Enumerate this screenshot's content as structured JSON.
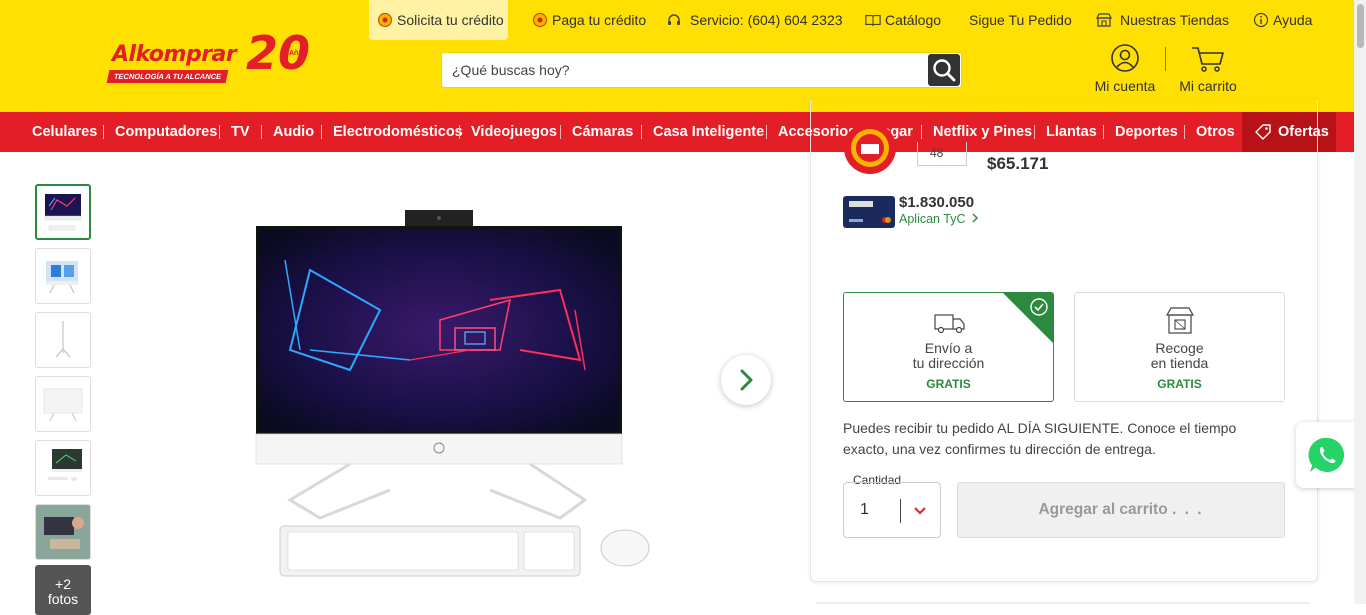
{
  "brand": {
    "name": "Alkomprar",
    "tagline": "TECNOLOGÍA A TU ALCANCE",
    "anniversary": "20",
    "anniversary_label": "Años"
  },
  "utility_bar": {
    "credit": "Solicita tu crédito",
    "pay_credit": "Paga tu crédito",
    "service": "Servicio: (604) 604 2323",
    "catalog": "Catálogo",
    "track_order": "Sigue Tu Pedido",
    "stores": "Nuestras Tiendas",
    "help": "Ayuda"
  },
  "search": {
    "placeholder": "¿Qué buscas hoy?"
  },
  "account": {
    "my_account": "Mi cuenta",
    "my_cart": "Mi carrito"
  },
  "nav": {
    "items": [
      "Celulares",
      "Computadores",
      "TV",
      "Audio",
      "Electrodomésticos",
      "Videojuegos",
      "Cámaras",
      "Casa Inteligente",
      "Accesorios",
      "Hogar",
      "Netflix y Pines",
      "Llantas",
      "Deportes",
      "Otros"
    ],
    "offers": "Ofertas"
  },
  "gallery": {
    "more_photos": "+2\nfotos"
  },
  "pricing": {
    "installments": "48",
    "installment_price": "$65.171",
    "card_price": "$1.830.050",
    "terms": "Aplican TyC"
  },
  "delivery": {
    "home_title": "Envío a\ntu dirección",
    "home_price": "GRATIS",
    "store_title": "Recoge\nen tienda",
    "store_price": "GRATIS",
    "info": "Puedes recibir tu pedido AL DÍA SIGUIENTE. Conoce el tiempo exacto, una vez confirmes tu dirección de entrega."
  },
  "purchase": {
    "quantity_label": "Cantidad",
    "quantity": "1",
    "add_to_cart": "Agregar al carrito"
  },
  "colors": {
    "brand_yellow": "#ffe000",
    "brand_red": "#e41e26",
    "accent_green": "#2b8a3e"
  }
}
